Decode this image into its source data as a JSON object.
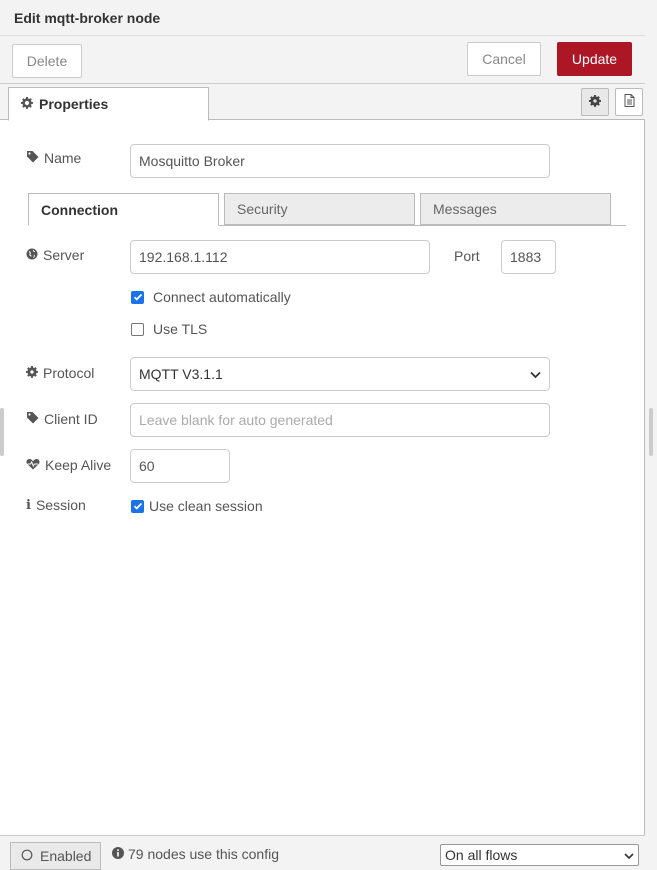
{
  "header": {
    "title": "Edit mqtt-broker node"
  },
  "toolbar": {
    "delete_label": "Delete",
    "cancel_label": "Cancel",
    "update_label": "Update"
  },
  "tabs": {
    "properties_label": "Properties"
  },
  "name": {
    "label": "Name",
    "value": "Mosquitto Broker"
  },
  "subtabs": [
    {
      "label": "Connection",
      "active": true
    },
    {
      "label": "Security",
      "active": false
    },
    {
      "label": "Messages",
      "active": false
    }
  ],
  "server": {
    "label": "Server",
    "value": "192.168.1.112",
    "port_label": "Port",
    "port_value": "1883"
  },
  "connect_automatically": {
    "label": "Connect automatically",
    "checked": true
  },
  "use_tls": {
    "label": "Use TLS",
    "checked": false
  },
  "protocol": {
    "label": "Protocol",
    "value": "MQTT V3.1.1"
  },
  "client_id": {
    "label": "Client ID",
    "value": "",
    "placeholder": "Leave blank for auto generated"
  },
  "keep_alive": {
    "label": "Keep Alive",
    "value": "60"
  },
  "session": {
    "label": "Session",
    "checkbox_label": "Use clean session",
    "checked": true
  },
  "footer": {
    "enabled_label": "Enabled",
    "usage_text": "79 nodes use this config",
    "scope_value": "On all flows"
  },
  "colors": {
    "accent": "#ad1625",
    "checkbox": "#1a73e8"
  }
}
